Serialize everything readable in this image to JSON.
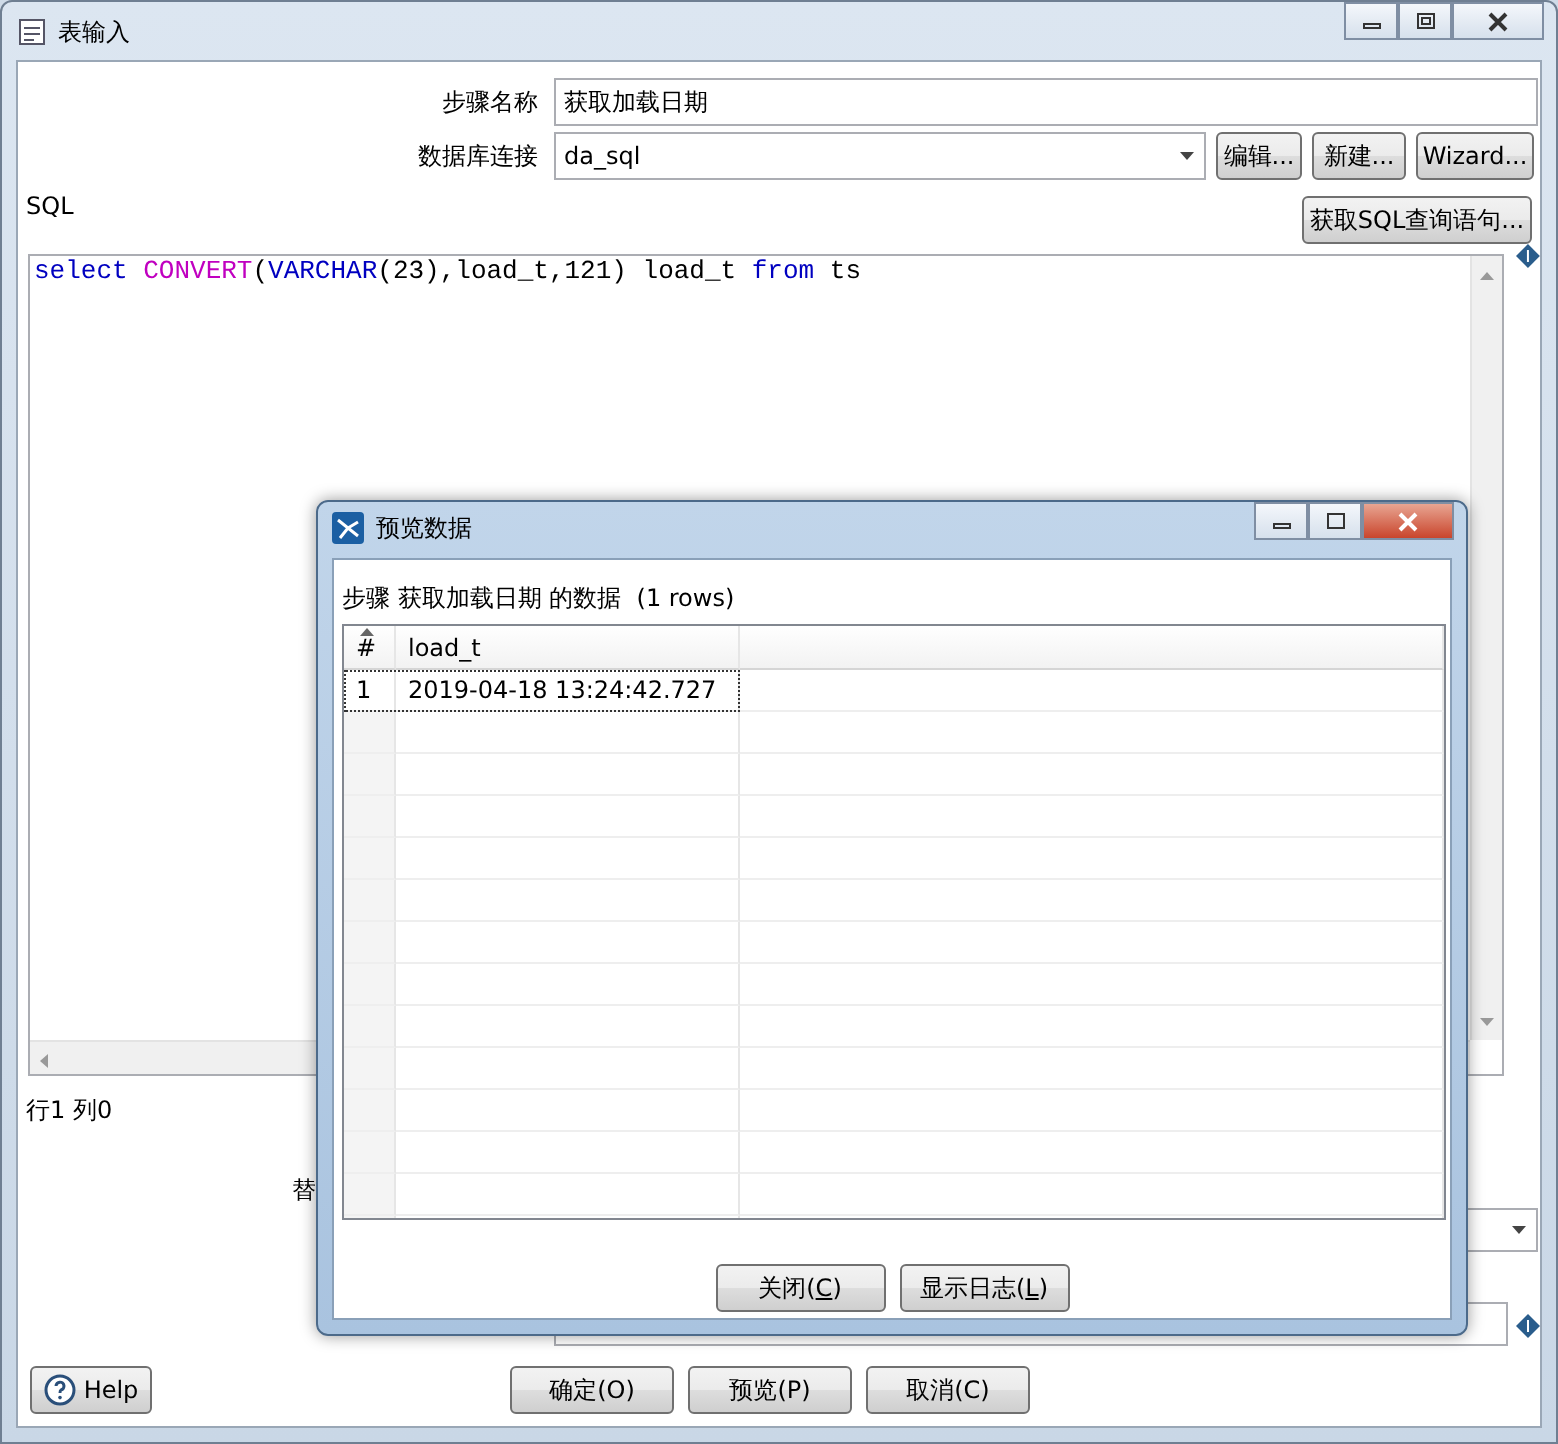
{
  "window": {
    "title": "表输入"
  },
  "form": {
    "step_name": {
      "label": "步骤名称",
      "value": "获取加载日期"
    },
    "connection": {
      "label": "数据库连接",
      "value": "da_sql",
      "buttons": [
        "编辑...",
        "新建...",
        "Wizard..."
      ]
    },
    "sql_label": "SQL",
    "get_sql_button": "获取SQL查询语句...",
    "sql": [
      {
        "kind": "keyword",
        "text": "select "
      },
      {
        "kind": "function",
        "text": "CONVERT"
      },
      {
        "kind": "plain",
        "text": "("
      },
      {
        "kind": "keyword",
        "text": "VARCHAR"
      },
      {
        "kind": "plain",
        "text": "(23),load_t,121) load_t "
      },
      {
        "kind": "keyword",
        "text": "from"
      },
      {
        "kind": "plain",
        "text": " ts"
      }
    ],
    "cursor_status": "行1 列0",
    "partial_label": "替"
  },
  "footer": {
    "help": "Help",
    "buttons": [
      "确定(O)",
      "预览(P)",
      "取消(C)"
    ]
  },
  "preview": {
    "title": "预览数据",
    "caption": "步骤 获取加载日期 的数据  (1 rows)",
    "table": {
      "columns": [
        "#",
        "load_t"
      ],
      "rows": [
        {
          "cells": [
            "1",
            "2019-04-18 13:24:42.727"
          ],
          "selected": true
        }
      ]
    },
    "buttons": [
      {
        "before": "关闭(",
        "key": "C",
        "after": ")"
      },
      {
        "before": "显示日志(",
        "key": "L",
        "after": ")"
      }
    ]
  }
}
